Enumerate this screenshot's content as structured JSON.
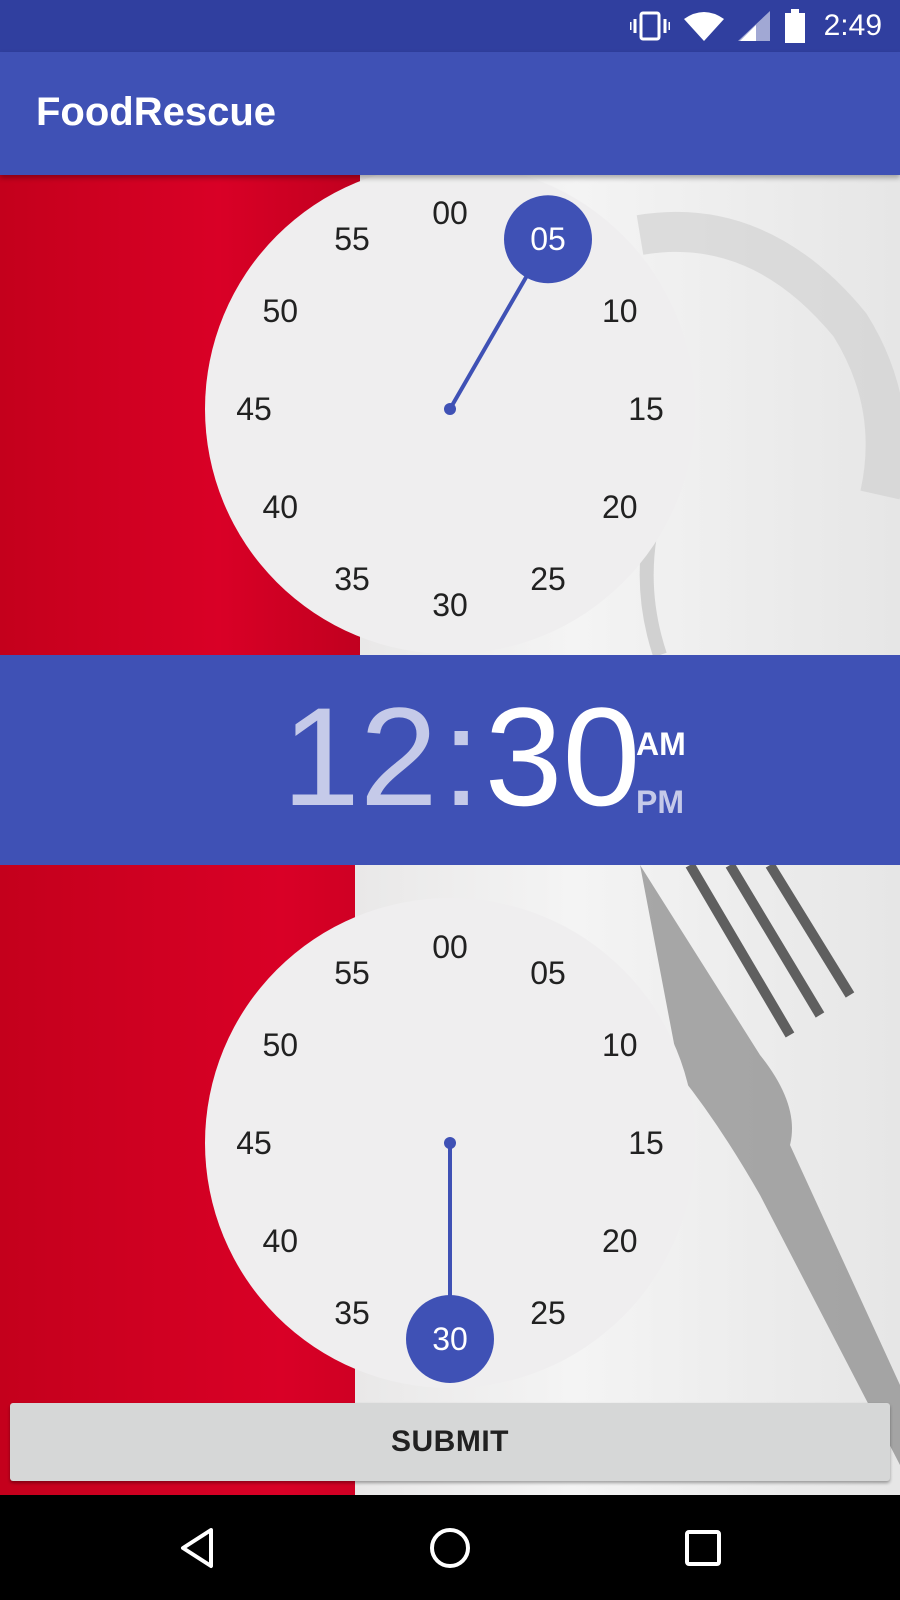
{
  "status_bar": {
    "time": "2:49",
    "icons": [
      "vibrate-icon",
      "wifi-icon",
      "signal-icon",
      "battery-icon"
    ]
  },
  "app_bar": {
    "title": "FoodRescue"
  },
  "top_clock": {
    "numbers": [
      "00",
      "05",
      "10",
      "15",
      "20",
      "25",
      "30",
      "35",
      "40",
      "45",
      "50",
      "55"
    ],
    "selected": "05"
  },
  "time_display": {
    "hour": "12",
    "separator": ":",
    "minute": "30",
    "am_label": "AM",
    "pm_label": "PM",
    "selected_period": "AM"
  },
  "bottom_clock": {
    "numbers": [
      "00",
      "05",
      "10",
      "15",
      "20",
      "25",
      "30",
      "35",
      "40",
      "45",
      "50",
      "55"
    ],
    "selected": "30"
  },
  "submit": {
    "label": "SUBMIT"
  },
  "nav_bar": {
    "items": [
      "back-icon",
      "home-icon",
      "recents-icon"
    ]
  },
  "colors": {
    "primary": "#3F51B5",
    "primary_dark": "#303F9F",
    "accent_light": "#C5CAE9",
    "clock_face": "#EFEEEF",
    "button": "#D6D7D7"
  }
}
